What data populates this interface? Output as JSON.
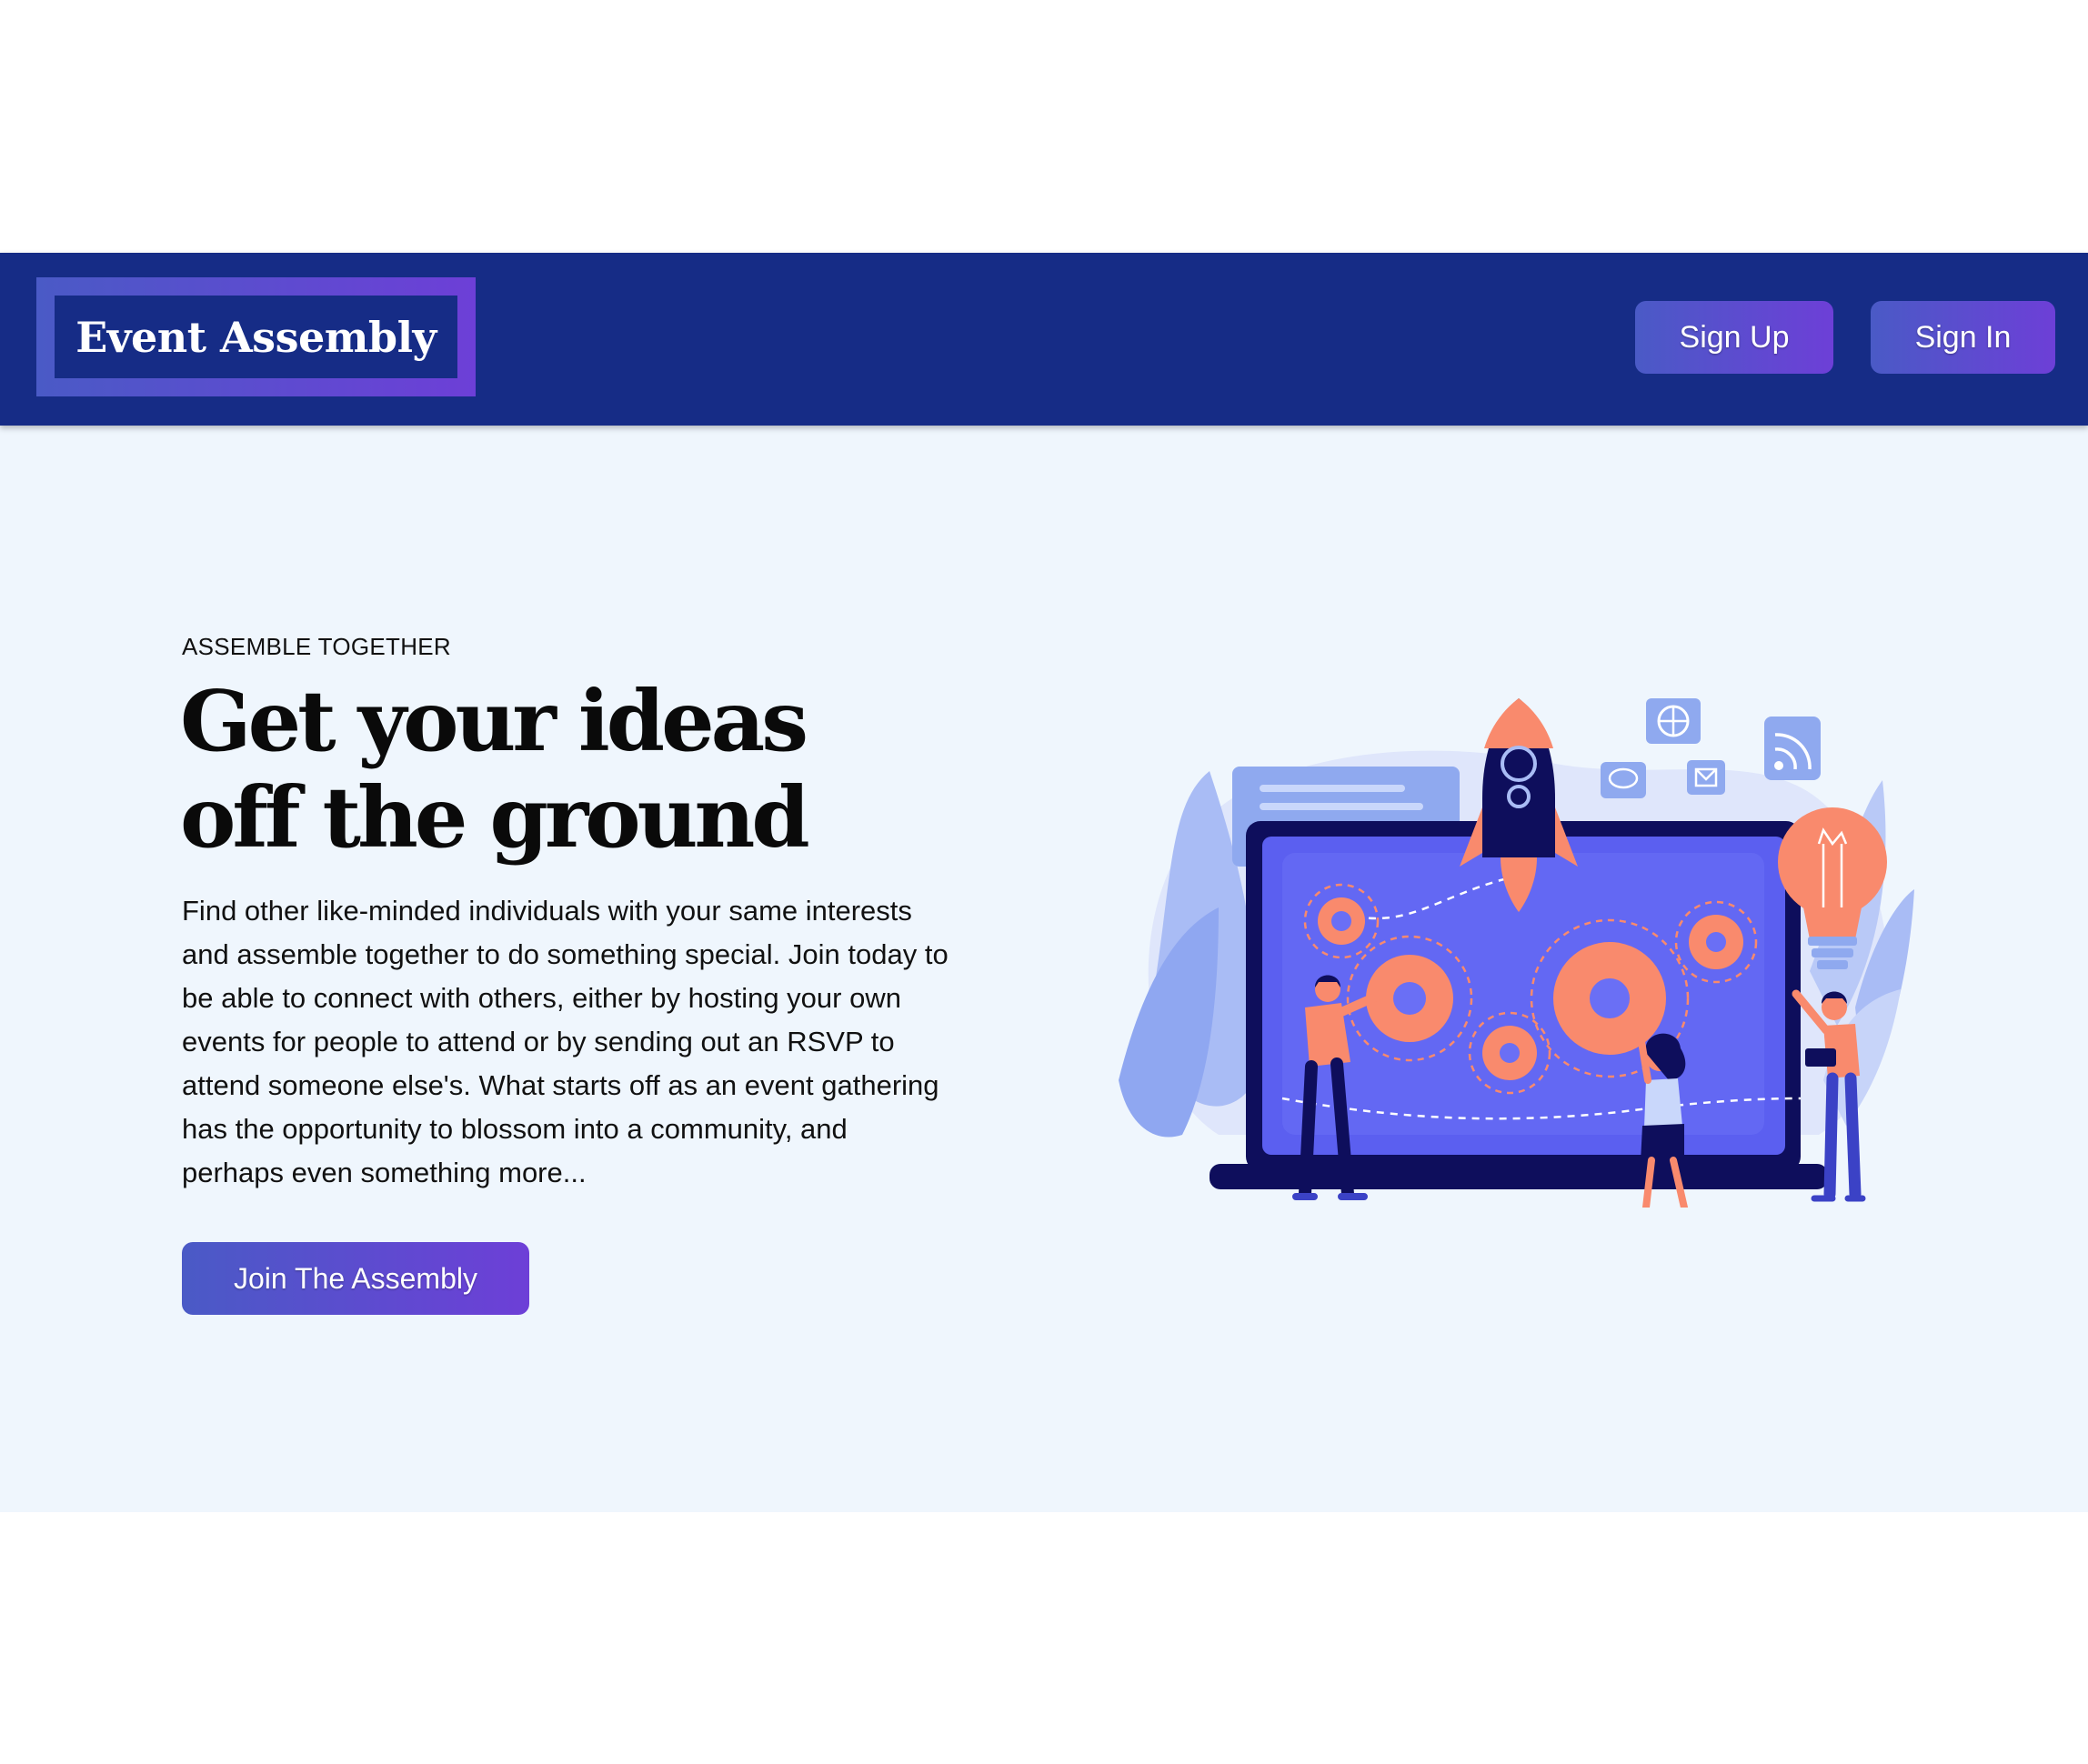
{
  "header": {
    "logo_text": "Event Assembly",
    "signup_label": "Sign Up",
    "signin_label": "Sign In"
  },
  "hero": {
    "eyebrow": "ASSEMBLE TOGETHER",
    "headline_line1": "Get your ideas",
    "headline_line2": "off the ground",
    "body": "Find other like-minded individuals with your same interests and assemble together to do something special. Join today to be able to connect with others, either by hosting your own events for people to attend or by sending out an RSVP to attend someone else's. What starts off as an event gathering has the opportunity to blossom into a community, and perhaps even something more...",
    "cta_label": "Join The Assembly"
  },
  "colors": {
    "navbar": "#162c86",
    "gradient_start": "#4a5ac6",
    "gradient_end": "#6d3fd7",
    "hero_background": "#eff6fd",
    "illustration_accent": "#f98a6d",
    "illustration_screen": "#5b5ff0"
  },
  "icons": [
    "rocket-icon",
    "globe-icon",
    "chat-icon",
    "mail-icon",
    "rss-icon",
    "lightbulb-icon",
    "gear-icon"
  ]
}
